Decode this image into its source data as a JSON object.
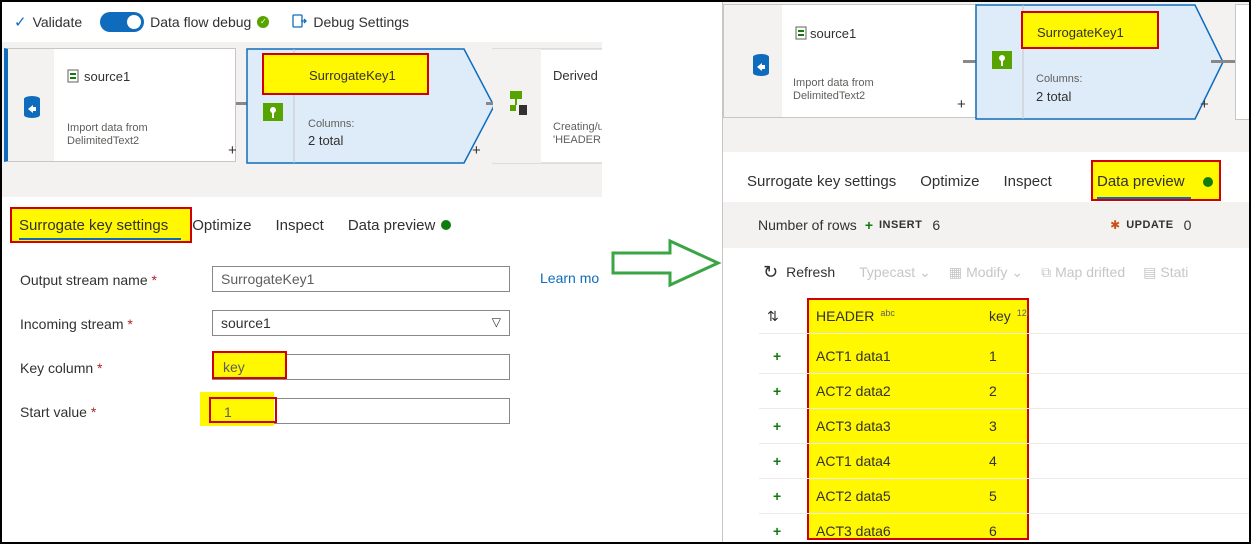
{
  "left": {
    "toolbar": {
      "validate_label": "Validate",
      "debug_label": "Data flow debug",
      "debug_settings_label": "Debug Settings"
    },
    "nodes": {
      "source": {
        "title": "source1",
        "sub_line1": "Import data from",
        "sub_line2": "DelimitedText2"
      },
      "surrogate": {
        "title": "SurrogateKey1",
        "columns_label": "Columns:",
        "columns_value": "2 total"
      },
      "derived": {
        "title": "Derived",
        "sub_line1": "Creating/u",
        "sub_line2": "'HEADER, "
      }
    },
    "tabs": [
      "Surrogate key settings",
      "Optimize",
      "Inspect",
      "Data preview"
    ],
    "form": {
      "output_stream_label": "Output stream name",
      "output_stream_value": "SurrogateKey1",
      "incoming_stream_label": "Incoming stream",
      "incoming_stream_value": "source1",
      "key_column_label": "Key column",
      "key_column_value": "key",
      "start_value_label": "Start value",
      "start_value_value": "1",
      "required_mark": "*",
      "learn_more": "Learn mo"
    }
  },
  "right": {
    "nodes": {
      "source": {
        "title": "source1",
        "sub_line1": "Import data from",
        "sub_line2": "DelimitedText2"
      },
      "surrogate": {
        "title": "SurrogateKey1",
        "columns_label": "Columns:",
        "columns_value": "2 total"
      }
    },
    "tabs": [
      "Surrogate key settings",
      "Optimize",
      "Inspect",
      "Data preview"
    ],
    "rows_bar": {
      "label": "Number of rows",
      "insert_label": "INSERT",
      "insert_count": "6",
      "update_label": "UPDATE",
      "update_count": "0"
    },
    "commands": {
      "refresh": "Refresh",
      "typecast": "Typecast",
      "modify": "Modify",
      "map_drifted": "Map drifted",
      "statistics": "Stati"
    },
    "grid": {
      "header_col": "HEADER",
      "header_type": "abc",
      "key_col": "key",
      "key_type": "12l",
      "rows": [
        {
          "header": "ACT1 data1",
          "key": "1"
        },
        {
          "header": "ACT2 data2",
          "key": "2"
        },
        {
          "header": "ACT3 data3",
          "key": "3"
        },
        {
          "header": "ACT1 data4",
          "key": "4"
        },
        {
          "header": "ACT2 data5",
          "key": "5"
        },
        {
          "header": "ACT3 data6",
          "key": "6"
        }
      ]
    }
  },
  "colors": {
    "highlight": "#fff800",
    "annotation_border": "#d00000",
    "arrow": "#3aa544",
    "accent": "#0f6cbd",
    "selected_node": "#deecf9"
  }
}
